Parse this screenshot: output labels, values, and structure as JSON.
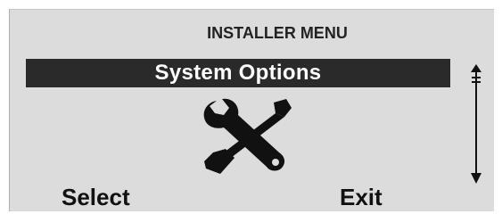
{
  "menu": {
    "title": "INSTALLER MENU",
    "selected_item": "System Options",
    "icon": "tools-icon"
  },
  "scrollbar": {
    "up_icon": "arrow-up-icon",
    "down_icon": "arrow-down-icon"
  },
  "softkeys": {
    "left_label": "Select",
    "right_label": "Exit"
  }
}
